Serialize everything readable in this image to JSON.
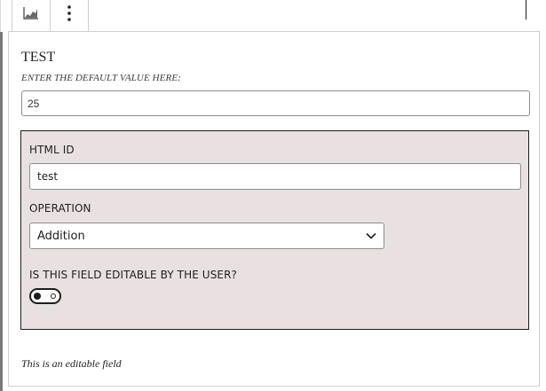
{
  "toolbar": {
    "block_icon": "chart-area-icon",
    "more_icon": "vertical-ellipsis-icon"
  },
  "block": {
    "title": "TEST",
    "default_label": "ENTER THE DEFAULT VALUE HERE:",
    "default_value": "25"
  },
  "settings": {
    "html_id_label": "HTML ID",
    "html_id_value": "test",
    "operation_label": "OPERATION",
    "operation_value": "Addition",
    "editable_label": "IS THIS FIELD EDITABLE BY THE USER?",
    "editable_on": false
  },
  "footer": {
    "note": "This is an editable field"
  },
  "colors": {
    "panel_bg": "#e9e1e1",
    "text": "#1e1e1e",
    "border": "#8c8c8c"
  }
}
